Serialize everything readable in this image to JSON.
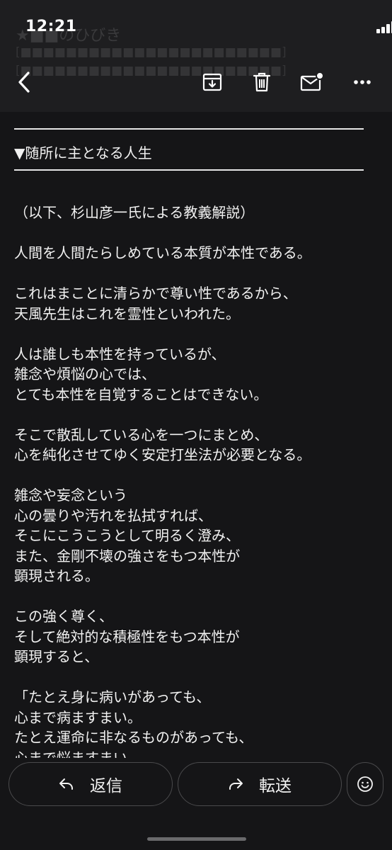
{
  "status_bar": {
    "time": "12:21"
  },
  "header": {
    "background_subject": "★■■のひびき",
    "background_lines": [
      "[■■■■■■■■■■■■■■■■■■■■■■■]",
      "[■■■■■■■■■■■■■■■■■■■■■■■]"
    ],
    "icons": [
      "back-chevron-icon",
      "archive-icon",
      "trash-icon",
      "mail-unread-icon",
      "more-icon"
    ]
  },
  "email": {
    "section_heading": "▼随所に主となる人生",
    "body": "（以下、杉山彦一氏による教義解説）\n\n人間を人間たらしめている本質が本性である。\n\nこれはまことに清らかで尊い性であるから、\n天風先生はこれを霊性といわれた。\n\n人は誰しも本性を持っているが、\n雑念や煩悩の心では、\nとても本性を自覚することはできない。\n\nそこで散乱している心を一つにまとめ、\n心を純化させてゆく安定打坐法が必要となる。\n\n雑念や妄念という\n心の曇りや汚れを払拭すれば、\nそこにこうこうとして明るく澄み、\nまた、金剛不壊の強さをもつ本性が\n顕現される。\n\nこの強く尊く、\nそして絶対的な積極性をもつ本性が\n顕現すると、\n\n「たとえ身に病いがあっても、\n心まで病ますまい。\nたとえ運命に非なるものがあっても、\n心まで悩ますまい"
  },
  "actions": {
    "reply_label": "返信",
    "forward_label": "転送"
  },
  "colors": {
    "background": "#151517",
    "toolbar": "#1e1e20",
    "battery": "#f4c400",
    "text": "#f2f2f2"
  }
}
